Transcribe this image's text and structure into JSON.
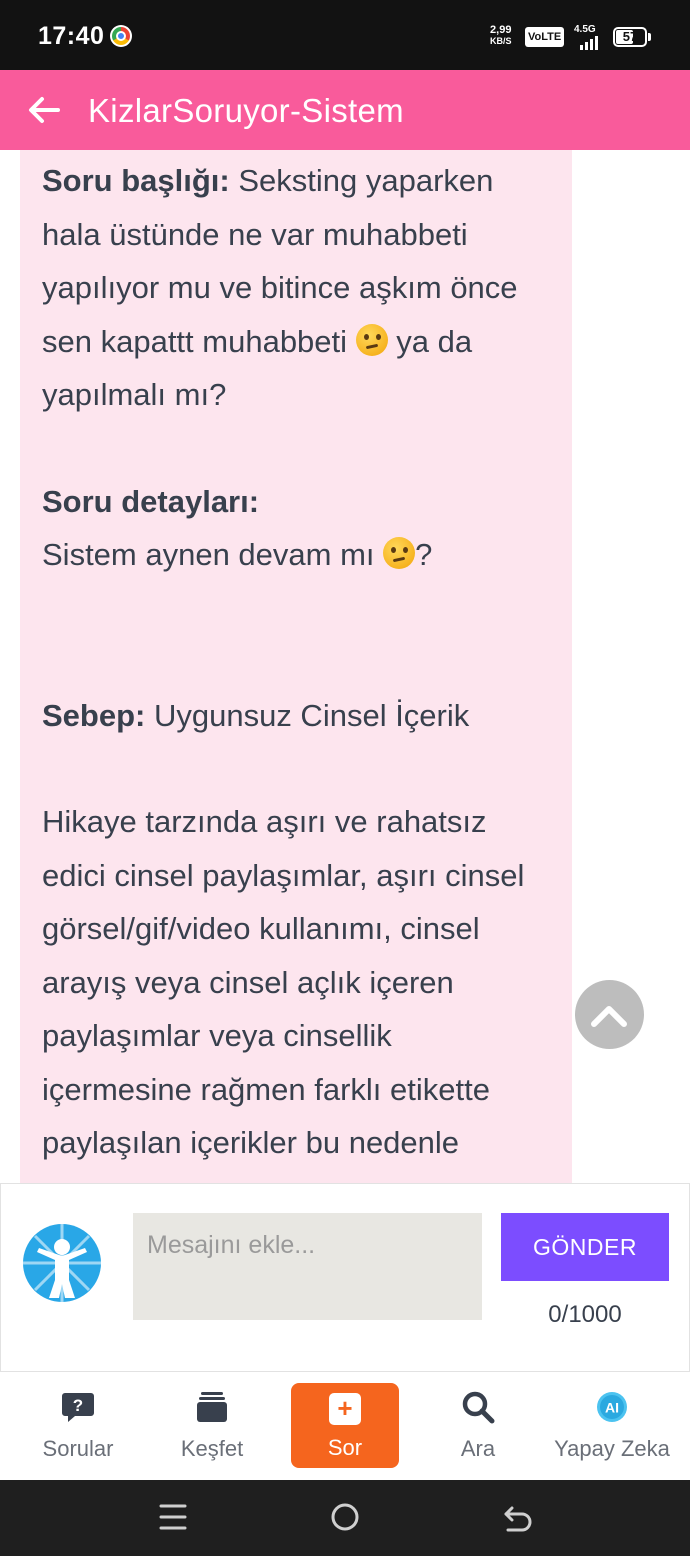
{
  "status_bar": {
    "time": "17:40",
    "net_speed_value": "2,99",
    "net_speed_unit": "KB/S",
    "volte": "VoLTE",
    "network": "4.5G",
    "battery": "57"
  },
  "app_bar": {
    "title": "KizlarSoruyor-Sistem"
  },
  "message": {
    "title_label": "Soru başlığı:",
    "title_text_1": " Seksting yaparken hala üstünde ne var muhabbeti yapılıyor mu ve bitince aşkım önce sen kapattt muhabbeti ",
    "title_text_2": " ya da yapılmalı mı?",
    "details_label": "Soru detayları:",
    "details_text_1": "Sistem aynen devam mı ",
    "details_text_2": "?",
    "reason_label": "Sebep:",
    "reason_text": " Uygunsuz Cinsel İçerik",
    "explanation": "Hikaye tarzında aşırı ve rahatsız edici cinsel paylaşımlar, aşırı cinsel görsel/gif/video kullanımı, cinsel arayış veya cinsel açlık içeren paylaşımlar veya cinsellik içermesine rağmen farklı etikette paylaşılan içerikler bu nedenle kaldırılır. Cinsellik etiketinde"
  },
  "composer": {
    "placeholder": "Mesajını ekle...",
    "send_label": "GÖNDER",
    "char_count": "0/1000"
  },
  "bottom_nav": {
    "items": [
      {
        "label": "Sorular",
        "icon": "question-bubble-icon"
      },
      {
        "label": "Keşfet",
        "icon": "cards-stack-icon"
      },
      {
        "label": "Sor",
        "icon": "plus-square-icon"
      },
      {
        "label": "Ara",
        "icon": "search-icon"
      },
      {
        "label": "Yapay Zeka",
        "icon": "ai-icon"
      }
    ]
  },
  "colors": {
    "app_bar": "#f95b9b",
    "bubble": "#fde5ee",
    "send_button": "#7c4dff",
    "sor_button": "#f5651e",
    "text": "#38404d"
  }
}
